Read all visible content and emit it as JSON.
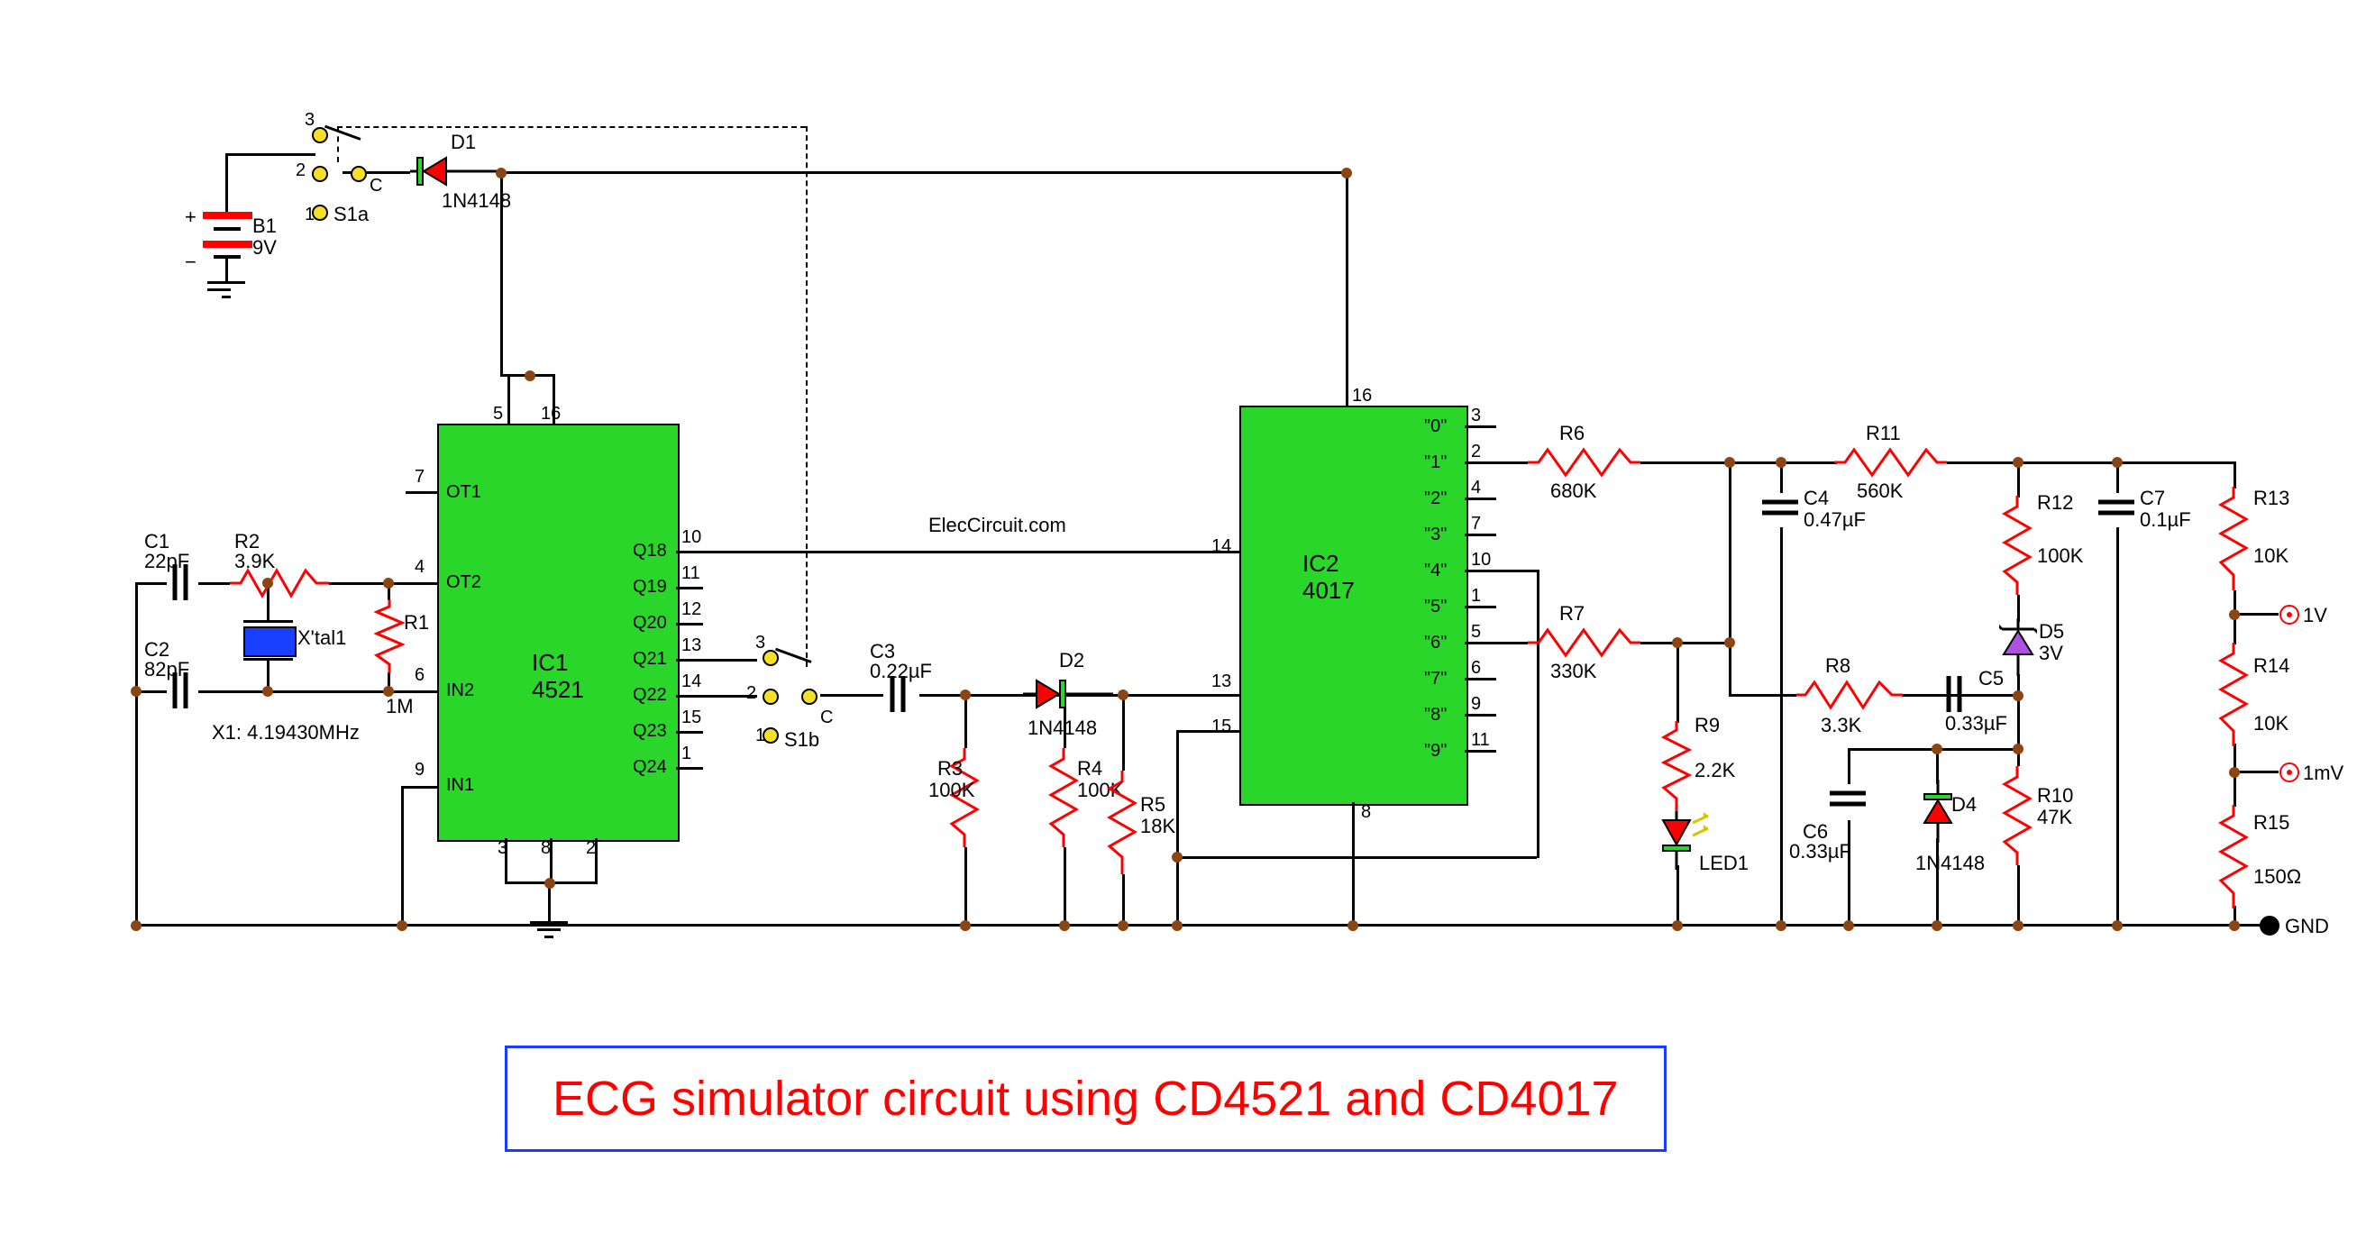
{
  "title": "ECG simulator circuit using CD4521 and CD4017",
  "source": "ElecCircuit.com",
  "ics": {
    "ic1": {
      "ref": "IC1",
      "part": "4521",
      "pins_left": [
        {
          "num": "7",
          "name": "OT1"
        },
        {
          "num": "4",
          "name": "OT2"
        },
        {
          "num": "6",
          "name": "IN2"
        },
        {
          "num": "9",
          "name": "IN1"
        }
      ],
      "pins_right": [
        {
          "num": "10",
          "name": "Q18"
        },
        {
          "num": "11",
          "name": "Q19"
        },
        {
          "num": "12",
          "name": "Q20"
        },
        {
          "num": "13",
          "name": "Q21"
        },
        {
          "num": "14",
          "name": "Q22"
        },
        {
          "num": "15",
          "name": "Q23"
        },
        {
          "num": "1",
          "name": "Q24"
        }
      ],
      "pins_top": [
        {
          "num": "5"
        },
        {
          "num": "16"
        }
      ],
      "pins_bot": [
        {
          "num": "3"
        },
        {
          "num": "8"
        },
        {
          "num": "2"
        }
      ]
    },
    "ic2": {
      "ref": "IC2",
      "part": "4017",
      "pins_left": [
        {
          "num": "14",
          "name": ""
        },
        {
          "num": "13",
          "name": ""
        },
        {
          "num": "15",
          "name": ""
        }
      ],
      "pins_right": [
        {
          "num": "3",
          "name": "\"0\""
        },
        {
          "num": "2",
          "name": "\"1\""
        },
        {
          "num": "4",
          "name": "\"2\""
        },
        {
          "num": "7",
          "name": "\"3\""
        },
        {
          "num": "10",
          "name": "\"4\""
        },
        {
          "num": "1",
          "name": "\"5\""
        },
        {
          "num": "5",
          "name": "\"6\""
        },
        {
          "num": "6",
          "name": "\"7\""
        },
        {
          "num": "9",
          "name": "\"8\""
        },
        {
          "num": "11",
          "name": "\"9\""
        }
      ],
      "pins_top": [
        {
          "num": "16"
        }
      ],
      "pins_bot": [
        {
          "num": "8"
        }
      ]
    }
  },
  "components": {
    "B1": {
      "ref": "B1",
      "value": "9V"
    },
    "S1a": {
      "ref": "S1a",
      "pos": [
        "1",
        "2",
        "3"
      ],
      "c": "C"
    },
    "S1b": {
      "ref": "S1b",
      "pos": [
        "1",
        "2",
        "3"
      ],
      "c": "C"
    },
    "D1": {
      "ref": "D1",
      "value": "1N4148"
    },
    "D2": {
      "ref": "D2",
      "value": "1N4148"
    },
    "D4": {
      "ref": "D4",
      "value": "1N4148"
    },
    "D5": {
      "ref": "D5",
      "value": "3V"
    },
    "LED1": {
      "ref": "LED1"
    },
    "X1": {
      "ref": "X'tal1",
      "value": "X1: 4.19430MHz"
    },
    "C1": {
      "ref": "C1",
      "value": "22pF"
    },
    "C2": {
      "ref": "C2",
      "value": "82pF"
    },
    "C3": {
      "ref": "C3",
      "value": "0.22µF"
    },
    "C4": {
      "ref": "C4",
      "value": "0.47µF"
    },
    "C5": {
      "ref": "C5",
      "value": "0.33µF"
    },
    "C6": {
      "ref": "C6",
      "value": "0.33µF"
    },
    "C7": {
      "ref": "C7",
      "value": "0.1µF"
    },
    "R1": {
      "ref": "R1",
      "value": "1M"
    },
    "R2": {
      "ref": "R2",
      "value": "3.9K"
    },
    "R3": {
      "ref": "R3",
      "value": "100K"
    },
    "R4": {
      "ref": "R4",
      "value": "100K"
    },
    "R5": {
      "ref": "R5",
      "value": "18K"
    },
    "R6": {
      "ref": "R6",
      "value": "680K"
    },
    "R7": {
      "ref": "R7",
      "value": "330K"
    },
    "R8": {
      "ref": "R8",
      "value": "3.3K"
    },
    "R9": {
      "ref": "R9",
      "value": "2.2K"
    },
    "R10": {
      "ref": "R10",
      "value": "47K"
    },
    "R11": {
      "ref": "R11",
      "value": "560K"
    },
    "R12": {
      "ref": "R12",
      "value": "100K"
    },
    "R13": {
      "ref": "R13",
      "value": "10K"
    },
    "R14": {
      "ref": "R14",
      "value": "10K"
    },
    "R15": {
      "ref": "R15",
      "value": "150Ω"
    }
  },
  "outputs": {
    "out1": "1V",
    "out2": "1mV",
    "gnd": "GND"
  }
}
